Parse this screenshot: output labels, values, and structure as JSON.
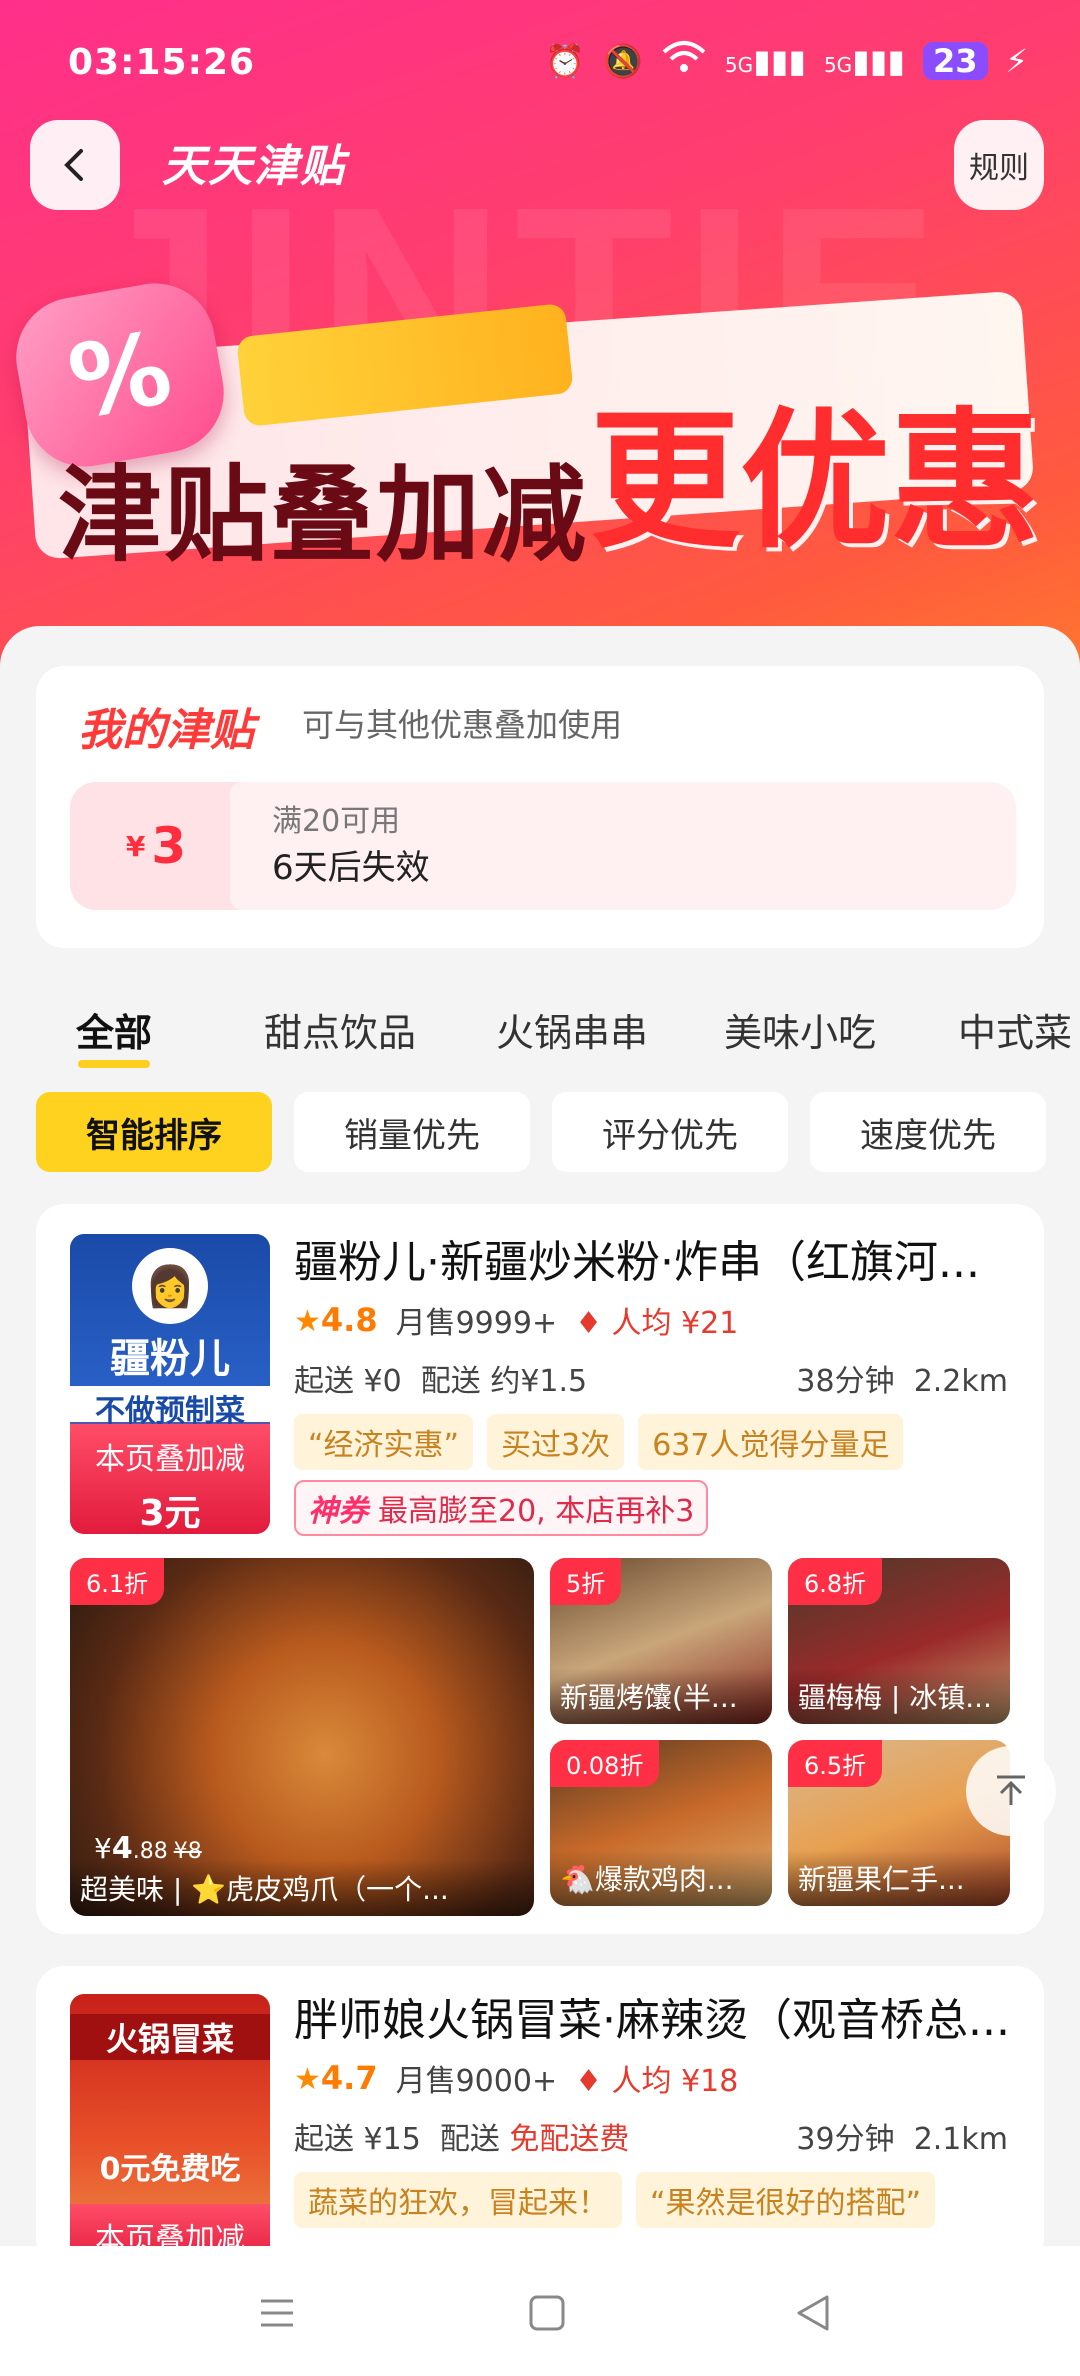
{
  "status_bar": {
    "time": "03:15:26",
    "signal1": "5G",
    "signal2": "5G",
    "battery": "23"
  },
  "header": {
    "title": "天天津贴",
    "rules_label": "规则",
    "watermark": "JINTIE"
  },
  "banner": {
    "percent": "%",
    "text_left": "津贴叠加减",
    "text_right": "更优惠"
  },
  "my_subsidy": {
    "title": "我的津贴",
    "subtitle": "可与其他优惠叠加使用",
    "currency": "¥",
    "amount": "3",
    "condition": "满20可用",
    "expiry": "6天后失效"
  },
  "tabs": [
    "全部",
    "甜点饮品",
    "火锅串串",
    "美味小吃",
    "中式菜"
  ],
  "sort_chips": [
    "智能排序",
    "销量优先",
    "评分优先",
    "速度优先"
  ],
  "stores": [
    {
      "name": "疆粉儿·新疆炒米粉·炸串（红旗河...",
      "logo_text": "疆粉儿",
      "logo_slogan": "不做预制菜",
      "caption1": "本页叠加减",
      "caption2": "3元",
      "rating": "4.8",
      "monthly": "月售9999+",
      "avg": "人均 ¥21",
      "min_order": "起送 ¥0",
      "delivery_label": "配送",
      "delivery_fee": "约¥1.5",
      "time": "38分钟",
      "distance": "2.2km",
      "tags": [
        "“经济实惠”",
        "买过3次",
        "637人觉得分量足"
      ],
      "coupon_prefix": "神券",
      "coupon_text": "最高膨至20, 本店再补3",
      "foods": [
        {
          "discount": "6.1折",
          "name": "超美味 | ⭐虎皮鸡爪（一个...",
          "price_int": "4",
          "price_dec": ".88",
          "orig": "¥8",
          "currency": "¥"
        },
        {
          "discount": "5折",
          "name": "新疆烤馕(半..."
        },
        {
          "discount": "6.8折",
          "name": "疆梅梅 | 冰镇..."
        },
        {
          "discount": "0.08折",
          "name": "🐔爆款鸡肉..."
        },
        {
          "discount": "6.5折",
          "name": "新疆果仁手..."
        }
      ]
    },
    {
      "name": "胖师娘火锅冒菜·麻辣烫（观音桥总...",
      "logo_text": "火锅冒菜",
      "logo_slogan": "0元免费吃",
      "caption1": "本页叠加减",
      "rating": "4.7",
      "monthly": "月售9000+",
      "avg": "人均 ¥18",
      "min_order": "起送 ¥15",
      "delivery_label": "配送",
      "delivery_fee": "免配送费",
      "time": "39分钟",
      "distance": "2.1km",
      "tags": [
        "蔬菜的狂欢，冒起来！",
        "“果然是很好的搭配”"
      ]
    }
  ],
  "colors": {
    "accent": "#ffd21f",
    "brand_red": "#ff2d3d",
    "hero_pink": "#ff2f8a",
    "hero_orange": "#ff7a2c"
  }
}
